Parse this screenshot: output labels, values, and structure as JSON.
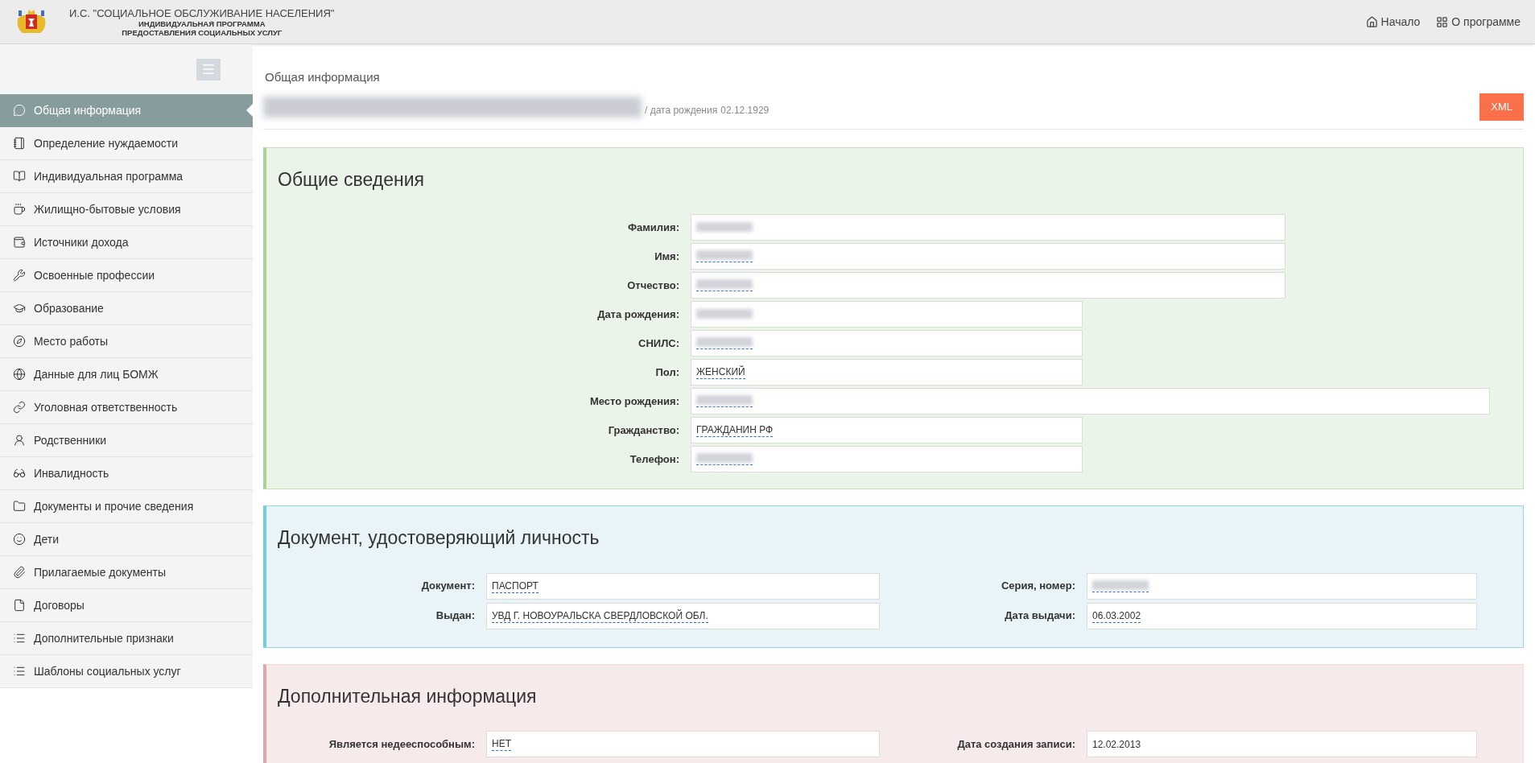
{
  "header": {
    "title": "И.С. \"СОЦИАЛЬНОЕ ОБСЛУЖИВАНИЕ НАСЕЛЕНИЯ\"",
    "subtitle_lines": [
      "ИНДИВИДУАЛЬНАЯ ПРОГРАММА",
      "ПРЕДОСТАВЛЕНИЯ СОЦИАЛЬНЫХ УСЛУГ"
    ],
    "nav": [
      {
        "label": "Начало"
      },
      {
        "label": "О программе"
      }
    ]
  },
  "sidebar": {
    "items": [
      {
        "label": "Общая информация",
        "selected": true
      },
      {
        "label": "Определение нуждаемости",
        "selected": false
      },
      {
        "label": "Индивидуальная программа",
        "selected": false
      },
      {
        "label": "Жилищно-бытовые условия",
        "selected": false
      },
      {
        "label": "Источники дохода",
        "selected": false
      },
      {
        "label": "Освоенные профессии",
        "selected": false
      },
      {
        "label": "Образование",
        "selected": false
      },
      {
        "label": "Место работы",
        "selected": false
      },
      {
        "label": "Данные для лиц БОМЖ",
        "selected": false
      },
      {
        "label": "Уголовная ответственность",
        "selected": false
      },
      {
        "label": "Родственники",
        "selected": false
      },
      {
        "label": "Инвалидность",
        "selected": false
      },
      {
        "label": "Документы и прочие сведения",
        "selected": false
      },
      {
        "label": "Дети",
        "selected": false
      },
      {
        "label": "Прилагаемые документы",
        "selected": false
      },
      {
        "label": "Договоры",
        "selected": false
      },
      {
        "label": "Дополнительные признаки",
        "selected": false
      },
      {
        "label": "Шаблоны социальных услуг",
        "selected": false
      }
    ]
  },
  "page": {
    "title": "Общая информация",
    "person": {
      "name_redacted": true,
      "birth_label": "/ дата рождения",
      "birth_date": "02.12.1929"
    },
    "xml_button": "XML"
  },
  "panels": [
    {
      "kind": "green",
      "title": "Общие сведения",
      "fields": [
        {
          "label": "Фамилия:",
          "redacted": true,
          "editable": false
        },
        {
          "label": "Имя:",
          "redacted": true,
          "editable": true
        },
        {
          "label": "Отчество:",
          "redacted": true,
          "editable": true
        },
        {
          "label": "Дата рождения:",
          "redacted": true,
          "editable": false
        },
        {
          "label": "СНИЛС:",
          "redacted": true,
          "editable": true
        },
        {
          "label": "Пол:",
          "value": "ЖЕНСКИЙ",
          "redacted": false,
          "editable": true
        },
        {
          "label": "Место рождения:",
          "redacted": true,
          "editable": true
        },
        {
          "label": "Гражданство:",
          "value": "ГРАЖДАНИН РФ",
          "redacted": false,
          "editable": true
        },
        {
          "label": "Телефон:",
          "redacted": true,
          "editable": true
        }
      ]
    },
    {
      "kind": "blue",
      "title": "Документ, удостоверяющий личность",
      "fields": [
        {
          "label": "Документ:",
          "value": "ПАСПОРТ",
          "redacted": false,
          "editable": true
        },
        {
          "label": "Серия, номер:",
          "redacted": true,
          "editable": true
        },
        {
          "label": "Выдан:",
          "value": "УВД Г. НОВОУРАЛЬСКА СВЕРДЛОВСКОЙ ОБЛ.",
          "redacted": false,
          "editable": true
        },
        {
          "label": "Дата выдачи:",
          "value": "06.03.2002",
          "redacted": false,
          "editable": true
        }
      ]
    },
    {
      "kind": "pink",
      "title": "Дополнительная информация",
      "fields": [
        {
          "label": "Является недееспособным:",
          "value": "НЕТ",
          "redacted": false,
          "editable": true
        },
        {
          "label": "Дата создания записи:",
          "value": "12.02.2013",
          "redacted": false,
          "editable": false
        }
      ]
    }
  ]
}
